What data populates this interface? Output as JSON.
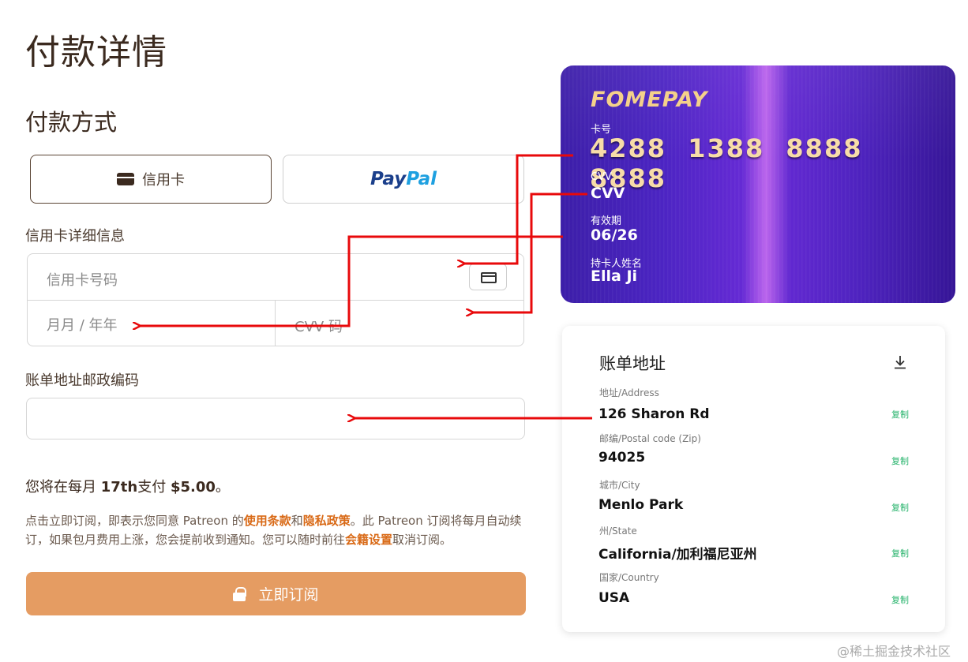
{
  "page": {
    "title": "付款详情"
  },
  "payment_method": {
    "title": "付款方式",
    "credit_card_label": "信用卡",
    "paypal_part1": "Pay",
    "paypal_part2": "Pal"
  },
  "card_details": {
    "label": "信用卡详细信息",
    "number_placeholder": "信用卡号码",
    "expiry_placeholder": "月月 / 年年",
    "cvv_placeholder": "CVV 码"
  },
  "zip": {
    "label": "账单地址邮政编码",
    "value": ""
  },
  "monthly": {
    "prefix": "您将在每月 ",
    "day": "17th",
    "middle": "支付 ",
    "amount": "$5.00",
    "suffix": "。"
  },
  "terms": {
    "part1": "点击立即订阅，即表示您同意 Patreon 的",
    "link1": "使用条款",
    "part2": "和",
    "link2": "隐私政策",
    "part3": "。此 Patreon 订阅将每月自动续订，如果包月费用上涨，您会提前收到通知。您可以随时前往",
    "link3": "会籍设置",
    "part4": "取消订阅。"
  },
  "subscribe": {
    "label": "立即订阅"
  },
  "credit_card": {
    "brand": "FOMEPAY",
    "number_label": "卡号",
    "number": "4288 1388 8888 8888",
    "cvv_label": "CVV",
    "cvv": "CVV",
    "expiry_label": "有效期",
    "expiry": "06/26",
    "holder_label": "持卡人姓名",
    "holder": "Ella Ji"
  },
  "billing": {
    "title": "账单地址",
    "copy_label": "复制",
    "fields": [
      {
        "label": "地址/Address",
        "value": "126 Sharon Rd"
      },
      {
        "label": "邮编/Postal code (Zip)",
        "value": "94025"
      },
      {
        "label": "城市/City",
        "value": "Menlo Park"
      },
      {
        "label": "州/State",
        "value": "California/加利福尼亚州"
      },
      {
        "label": "国家/Country",
        "value": "USA"
      }
    ]
  },
  "watermark": "@稀土掘金技术社区",
  "colors": {
    "accent_button": "#e59c62",
    "link": "#d96a17",
    "copy_green": "#26b36b",
    "annotation_arrow": "#e8090b"
  }
}
